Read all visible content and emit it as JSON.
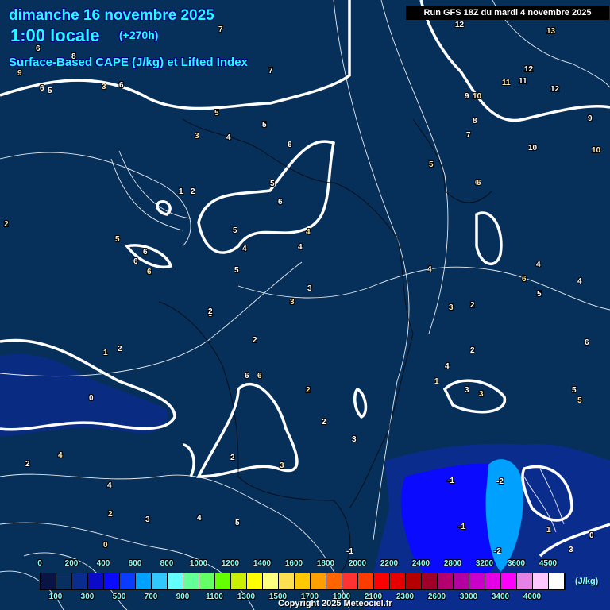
{
  "header": {
    "date": "dimanche 16 novembre 2025",
    "time": "1:00 locale",
    "lead": "(+270h)",
    "parameter": "Surface-Based CAPE (J/kg) et Lifted Index",
    "run": "Run GFS 18Z du mardi 4 novembre 2025"
  },
  "colorbar": {
    "top_labels": [
      "0",
      "200",
      "400",
      "600",
      "800",
      "1000",
      "1200",
      "1400",
      "1600",
      "1800",
      "2000",
      "2200",
      "2400",
      "2800",
      "3200",
      "3600",
      "4500"
    ],
    "bottom_labels": [
      "100",
      "300",
      "500",
      "700",
      "900",
      "1100",
      "1300",
      "1500",
      "1700",
      "1900",
      "2100",
      "2300",
      "2600",
      "3000",
      "3400",
      "4000"
    ],
    "unit": "(J/kg)",
    "colors": [
      "#0a1444",
      "#073060",
      "#0a2c8c",
      "#0a0ac8",
      "#0a0aff",
      "#0a3cff",
      "#00a0ff",
      "#30c8ff",
      "#64ffff",
      "#64ff96",
      "#64ff64",
      "#64ff00",
      "#c8f000",
      "#ffff00",
      "#ffff80",
      "#ffe050",
      "#ffc800",
      "#ffa000",
      "#ff6400",
      "#ff3232",
      "#ff3c00",
      "#ff0000",
      "#e60000",
      "#b40000",
      "#a00028",
      "#b4006e",
      "#b400a0",
      "#c800c8",
      "#e600e6",
      "#ff00ff",
      "#e682e6",
      "#ffc8ff",
      "#ffffff"
    ]
  },
  "lifted_index_labels": [
    "7",
    "6",
    "8",
    "9",
    "6",
    "5",
    "3",
    "6",
    "7",
    "5",
    "5",
    "4",
    "3",
    "6",
    "5",
    "2",
    "1",
    "2",
    "5",
    "6",
    "6",
    "6",
    "5",
    "4",
    "4",
    "4",
    "3",
    "3",
    "3",
    "2",
    "1",
    "2",
    "0",
    "4",
    "2",
    "4",
    "2",
    "4",
    "3",
    "0",
    "2",
    "5",
    "6",
    "6",
    "2",
    "3",
    "3",
    "2",
    "2",
    "5",
    "6",
    "5",
    "6",
    "4",
    "3",
    "2",
    "2",
    "1",
    "4",
    "3",
    "3",
    "4",
    "5",
    "6",
    "4",
    "5",
    "5",
    "6",
    "12",
    "13",
    "12",
    "11",
    "11",
    "12",
    "9",
    "10",
    "8",
    "7",
    "6",
    "10",
    "9",
    "10",
    "-1",
    "-2",
    "-1",
    "-2",
    "-1",
    "1",
    "0",
    "3"
  ],
  "copyright": "Copyright 2025 Meteociel.fr"
}
